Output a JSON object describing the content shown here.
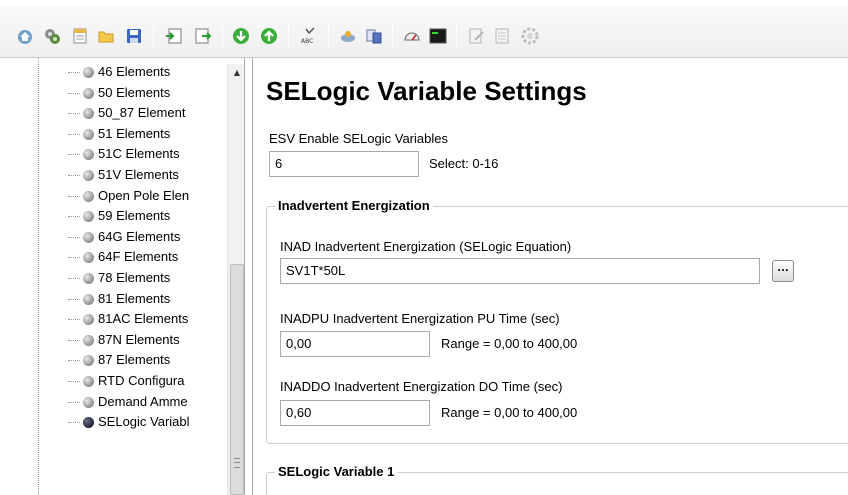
{
  "toolbar": {
    "buttons": [
      {
        "name": "home-icon",
        "glyph": "⌂"
      },
      {
        "name": "settings-gears-icon",
        "glyph": "⚙"
      },
      {
        "name": "new-document-icon",
        "glyph": "▤"
      },
      {
        "name": "open-folder-icon",
        "glyph": "▰"
      },
      {
        "name": "save-icon",
        "glyph": "▣"
      },
      {
        "name": "import-icon",
        "glyph": "⇲"
      },
      {
        "name": "export-icon",
        "glyph": "⇱"
      },
      {
        "name": "download-icon",
        "glyph": "↓"
      },
      {
        "name": "upload-icon",
        "glyph": "↑"
      },
      {
        "name": "spell-check-icon",
        "glyph": "ABC"
      },
      {
        "name": "connect-icon",
        "glyph": "◈"
      },
      {
        "name": "compare-icon",
        "glyph": "▦"
      },
      {
        "name": "meter-icon",
        "glyph": "◠"
      },
      {
        "name": "terminal-icon",
        "glyph": "▮"
      },
      {
        "name": "edit-icon",
        "glyph": "✎"
      },
      {
        "name": "report-icon",
        "glyph": "☰"
      },
      {
        "name": "options-gear-icon",
        "glyph": "✲"
      }
    ]
  },
  "tree": {
    "items": [
      {
        "label": "46 Elements",
        "selected": false
      },
      {
        "label": "50 Elements",
        "selected": false
      },
      {
        "label": "50_87 Element",
        "selected": false
      },
      {
        "label": "51 Elements",
        "selected": false
      },
      {
        "label": "51C Elements",
        "selected": false
      },
      {
        "label": "51V Elements",
        "selected": false
      },
      {
        "label": "Open Pole Elen",
        "selected": false
      },
      {
        "label": "59 Elements",
        "selected": false
      },
      {
        "label": "64G Elements",
        "selected": false
      },
      {
        "label": "64F Elements",
        "selected": false
      },
      {
        "label": "78 Elements",
        "selected": false
      },
      {
        "label": "81 Elements",
        "selected": false
      },
      {
        "label": "81AC Elements",
        "selected": false
      },
      {
        "label": "87N Elements",
        "selected": false
      },
      {
        "label": "87 Elements",
        "selected": false
      },
      {
        "label": "RTD Configura",
        "selected": false
      },
      {
        "label": "Demand Amme",
        "selected": false
      },
      {
        "label": "SELogic Variabl",
        "selected": true
      }
    ]
  },
  "page": {
    "title": "SELogic Variable Settings",
    "esv": {
      "label": "ESV  Enable SELogic Variables",
      "value": "6",
      "hint": "Select: 0-16"
    },
    "inadvertent": {
      "title": "Inadvertent Energization",
      "inad": {
        "label": "INAD  Inadvertent Energization (SELogic Equation)",
        "value": "SV1T*50L",
        "button": "..."
      },
      "inadpu": {
        "label": "INADPU  Inadvertent Energization PU Time (sec)",
        "value": "0,00",
        "range": "Range = 0,00 to 400,00"
      },
      "inaddo": {
        "label": "INADDO  Inadvertent Energization DO Time (sec)",
        "value": "0,60",
        "range": "Range = 0,00 to 400,00"
      }
    },
    "selogic1": {
      "title": "SELogic Variable 1"
    }
  }
}
